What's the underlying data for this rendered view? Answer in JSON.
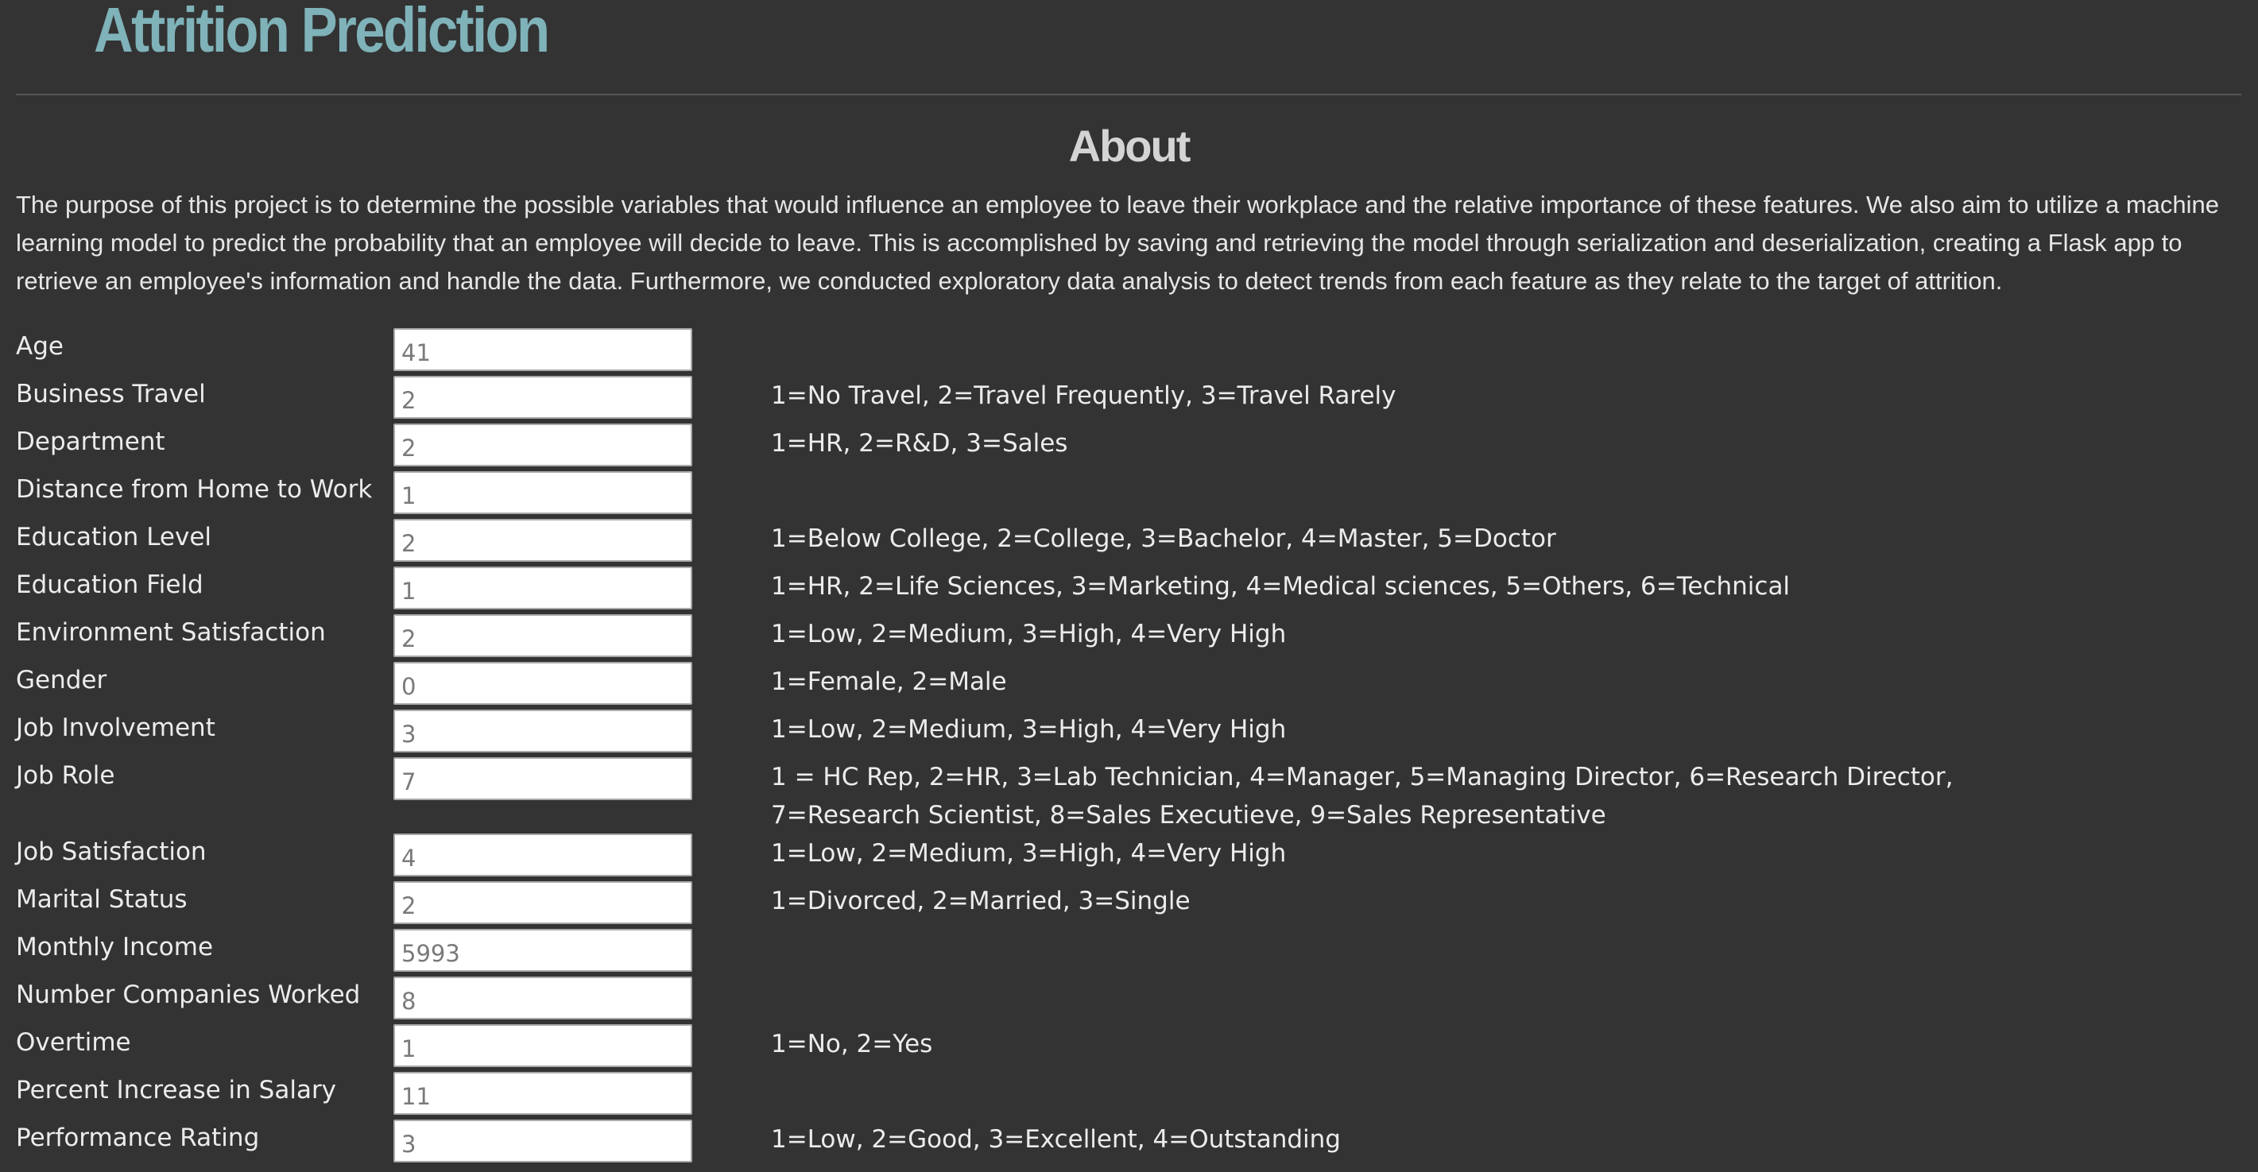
{
  "header": {
    "title": "Attrition Prediction"
  },
  "about": {
    "heading": "About",
    "text": "The purpose of this project is to determine the possible variables that would influence an employee to leave their workplace and the relative importance of these features. We also aim to utilize a machine learning model to predict the probability that an employee will decide to leave. This is accomplished by saving and retrieving the model through serialization and deserialization, creating a Flask app to retrieve an employee's information and handle the data. Furthermore, we conducted exploratory data analysis to detect trends from each feature as they relate to the target of attrition."
  },
  "form": {
    "fields": [
      {
        "label": "Age",
        "value": "41",
        "hint": ""
      },
      {
        "label": "Business Travel",
        "value": "2",
        "hint": "1=No Travel, 2=Travel Frequently, 3=Travel Rarely"
      },
      {
        "label": "Department",
        "value": "2",
        "hint": "1=HR, 2=R&D, 3=Sales"
      },
      {
        "label": "Distance from Home to Work",
        "value": "1",
        "hint": ""
      },
      {
        "label": "Education Level",
        "value": "2",
        "hint": "1=Below College, 2=College, 3=Bachelor, 4=Master, 5=Doctor"
      },
      {
        "label": "Education Field",
        "value": "1",
        "hint": "1=HR, 2=Life Sciences, 3=Marketing, 4=Medical sciences, 5=Others, 6=Technical"
      },
      {
        "label": "Environment Satisfaction",
        "value": "2",
        "hint": "1=Low, 2=Medium, 3=High, 4=Very High"
      },
      {
        "label": "Gender",
        "value": "0",
        "hint": "1=Female, 2=Male"
      },
      {
        "label": "Job Involvement",
        "value": "3",
        "hint": "1=Low, 2=Medium, 3=High, 4=Very High"
      },
      {
        "label": "Job Role",
        "value": "7",
        "hint": "1 = HC Rep, 2=HR, 3=Lab Technician, 4=Manager, 5=Managing Director, 6=Research Director, 7=Research Scientist, 8=Sales Executieve, 9=Sales Representative"
      },
      {
        "label": "Job Satisfaction",
        "value": "4",
        "hint": "1=Low, 2=Medium, 3=High, 4=Very High"
      },
      {
        "label": "Marital Status",
        "value": "2",
        "hint": "1=Divorced, 2=Married, 3=Single"
      },
      {
        "label": "Monthly Income",
        "value": "5993",
        "hint": ""
      },
      {
        "label": "Number Companies Worked",
        "value": "8",
        "hint": ""
      },
      {
        "label": "Overtime",
        "value": "1",
        "hint": "1=No, 2=Yes"
      },
      {
        "label": "Percent Increase in Salary",
        "value": "11",
        "hint": ""
      },
      {
        "label": "Performance Rating",
        "value": "3",
        "hint": "1=Low, 2=Good, 3=Excellent, 4=Outstanding"
      }
    ]
  }
}
